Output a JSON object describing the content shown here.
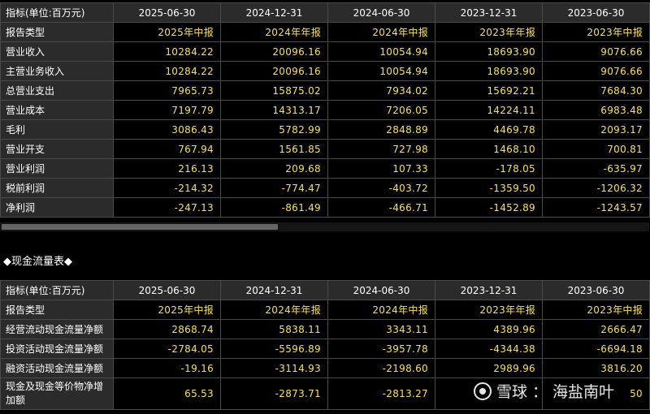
{
  "income": {
    "header": [
      "指标(单位:百万元)",
      "2025-06-30",
      "2024-12-31",
      "2024-06-30",
      "2023-12-31",
      "2023-06-30"
    ],
    "rows": [
      {
        "label": "报告类型",
        "values": [
          "2025年中报",
          "2024年年报",
          "2024年中报",
          "2023年年报",
          "2023年中报"
        ]
      },
      {
        "label": "营业收入",
        "values": [
          "10284.22",
          "20096.16",
          "10054.94",
          "18693.90",
          "9076.66"
        ]
      },
      {
        "label": "主营业务收入",
        "values": [
          "10284.22",
          "20096.16",
          "10054.94",
          "18693.90",
          "9076.66"
        ]
      },
      {
        "label": "总营业支出",
        "values": [
          "7965.73",
          "15875.02",
          "7934.02",
          "15692.21",
          "7684.30"
        ]
      },
      {
        "label": "营业成本",
        "values": [
          "7197.79",
          "14313.17",
          "7206.05",
          "14224.11",
          "6983.48"
        ]
      },
      {
        "label": "毛利",
        "values": [
          "3086.43",
          "5782.99",
          "2848.89",
          "4469.78",
          "2093.17"
        ]
      },
      {
        "label": "营业开支",
        "values": [
          "767.94",
          "1561.85",
          "727.98",
          "1468.10",
          "700.81"
        ]
      },
      {
        "label": "营业利润",
        "values": [
          "216.13",
          "209.68",
          "107.33",
          "-178.05",
          "-635.97"
        ]
      },
      {
        "label": "税前利润",
        "values": [
          "-214.32",
          "-774.47",
          "-403.72",
          "-1359.50",
          "-1206.32"
        ]
      },
      {
        "label": "净利润",
        "values": [
          "-247.13",
          "-861.49",
          "-466.71",
          "-1452.89",
          "-1243.57"
        ]
      }
    ]
  },
  "cashflow_section_title": "◆现金流量表◆",
  "cashflow": {
    "header": [
      "指标(单位:百万元)",
      "2025-06-30",
      "2024-12-31",
      "2024-06-30",
      "2023-12-31",
      "2023-06-30"
    ],
    "rows": [
      {
        "label": "报告类型",
        "values": [
          "2025年中报",
          "2024年年报",
          "2024年中报",
          "2023年年报",
          "2023年中报"
        ]
      },
      {
        "label": "经营流动现金流量净额",
        "values": [
          "2868.74",
          "5838.11",
          "3343.11",
          "4389.96",
          "2666.47"
        ]
      },
      {
        "label": "投资活动现金流量净额",
        "values": [
          "-2784.05",
          "-5596.89",
          "-3957.78",
          "-4344.38",
          "-6694.18"
        ]
      },
      {
        "label": "融资活动现金流量净额",
        "values": [
          "-19.16",
          "-3114.93",
          "-2198.60",
          "2989.96",
          "3816.20"
        ]
      },
      {
        "label": "现金及现金等价物净增加额",
        "values": [
          "65.53",
          "-2873.71",
          "-2813.27",
          "",
          "50"
        ]
      }
    ]
  },
  "watermark": {
    "brand": "雪球",
    "separator": "：",
    "author": "海盐南叶"
  },
  "colors": {
    "value_text": "#f6e256",
    "label_bg": "#2b2b2b",
    "page_bg": "#000000",
    "border": "#4a4a4a"
  }
}
